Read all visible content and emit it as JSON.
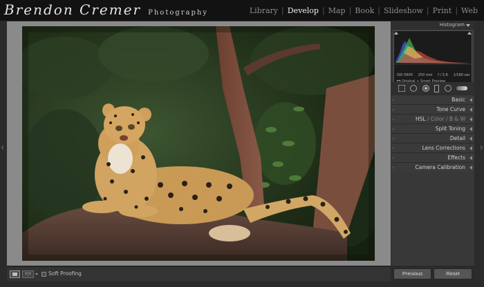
{
  "brand": {
    "name": "Brendon Cremer",
    "subtitle": "Photography"
  },
  "modules": [
    {
      "label": "Library",
      "active": false
    },
    {
      "label": "Develop",
      "active": true
    },
    {
      "label": "Map",
      "active": false
    },
    {
      "label": "Book",
      "active": false
    },
    {
      "label": "Slideshow",
      "active": false
    },
    {
      "label": "Print",
      "active": false
    },
    {
      "label": "Web",
      "active": false
    }
  ],
  "histogram": {
    "title": "Histogram",
    "iso": "ISO 5600",
    "focal": "250 mm",
    "aperture": "f / 5.6",
    "shutter": "1/160 sec",
    "preview_text": "Original + Smart Preview"
  },
  "tools": [
    "crop-overlay-icon",
    "spot-removal-icon",
    "red-eye-icon",
    "graduated-filter-icon",
    "radial-filter-icon",
    "adjustment-brush-icon"
  ],
  "sections": {
    "basic": "Basic",
    "tone_curve": "Tone Curve",
    "hsl_a": "HSL",
    "hsl_sep1": "/",
    "hsl_b": "Color",
    "hsl_sep2": "/",
    "hsl_c": "B & W",
    "split_toning": "Split Toning",
    "detail": "Detail",
    "lens_corrections": "Lens Corrections",
    "effects": "Effects",
    "camera_calibration": "Camera Calibration"
  },
  "bottombar": {
    "compare_label": "Y|Y",
    "soft_proofing": "Soft Proofing"
  },
  "buttons": {
    "previous": "Previous",
    "reset": "Reset"
  },
  "colors": {
    "topbar": "#121212",
    "panel": "#383838",
    "canvas": "#8a8a8a",
    "accent_active": "#f2f2f2"
  }
}
